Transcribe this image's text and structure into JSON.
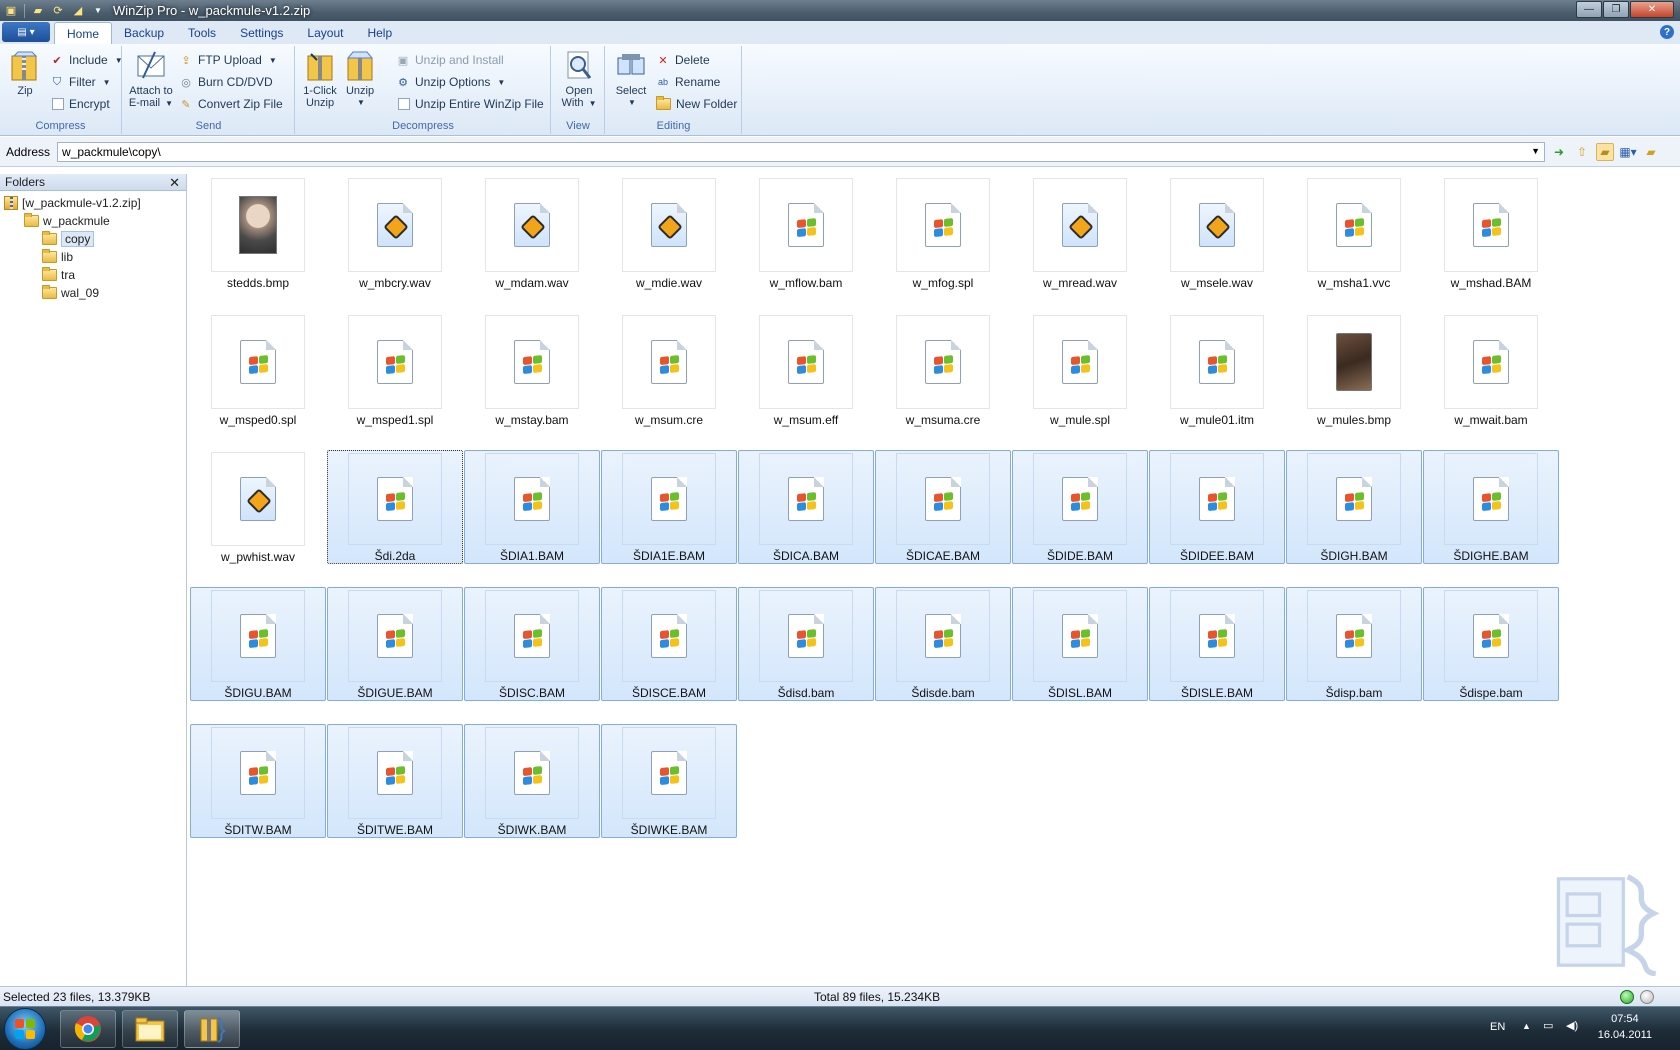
{
  "window": {
    "title": "WinZip Pro - w_packmule-v1.2.zip"
  },
  "tabs": [
    {
      "label": "Home",
      "active": true
    },
    {
      "label": "Backup"
    },
    {
      "label": "Tools"
    },
    {
      "label": "Settings"
    },
    {
      "label": "Layout"
    },
    {
      "label": "Help"
    }
  ],
  "ribbon": {
    "compress": {
      "label": "Compress",
      "zip": "Zip",
      "include": "Include",
      "filter": "Filter",
      "encrypt": "Encrypt"
    },
    "send": {
      "label": "Send",
      "attach_line1": "Attach to",
      "attach_line2": "E-mail",
      "ftp_upload": "FTP Upload",
      "burn": "Burn CD/DVD",
      "convert": "Convert Zip File"
    },
    "decompress": {
      "label": "Decompress",
      "oneclick_line1": "1-Click",
      "oneclick_line2": "Unzip",
      "unzip": "Unzip",
      "unzip_install": "Unzip and Install",
      "unzip_options": "Unzip Options",
      "unzip_entire": "Unzip Entire WinZip File"
    },
    "view": {
      "label": "View",
      "open_line1": "Open",
      "open_line2": "With"
    },
    "editing": {
      "label": "Editing",
      "select": "Select",
      "delete": "Delete",
      "rename": "Rename",
      "new_folder": "New Folder"
    }
  },
  "address": {
    "label": "Address",
    "value": "w_packmule\\copy\\"
  },
  "folders": {
    "header": "Folders",
    "root": "[w_packmule-v1.2.zip]",
    "child": "w_packmule",
    "items": [
      "copy",
      "lib",
      "tra",
      "wal_09"
    ],
    "selected": "copy"
  },
  "files": [
    {
      "name": "stedds.bmp",
      "type": "photo-person",
      "selected": false
    },
    {
      "name": "w_mbcry.wav",
      "type": "wav",
      "selected": false
    },
    {
      "name": "w_mdam.wav",
      "type": "wav",
      "selected": false
    },
    {
      "name": "w_mdie.wav",
      "type": "wav",
      "selected": false
    },
    {
      "name": "w_mflow.bam",
      "type": "win",
      "selected": false
    },
    {
      "name": "w_mfog.spl",
      "type": "win",
      "selected": false
    },
    {
      "name": "w_mread.wav",
      "type": "wav",
      "selected": false
    },
    {
      "name": "w_msele.wav",
      "type": "wav",
      "selected": false
    },
    {
      "name": "w_msha1.vvc",
      "type": "win",
      "selected": false
    },
    {
      "name": "w_mshad.BAM",
      "type": "win",
      "selected": false
    },
    {
      "name": "w_msped0.spl",
      "type": "win",
      "selected": false
    },
    {
      "name": "w_msped1.spl",
      "type": "win",
      "selected": false
    },
    {
      "name": "w_mstay.bam",
      "type": "win",
      "selected": false
    },
    {
      "name": "w_msum.cre",
      "type": "win",
      "selected": false
    },
    {
      "name": "w_msum.eff",
      "type": "win",
      "selected": false
    },
    {
      "name": "w_msuma.cre",
      "type": "win",
      "selected": false
    },
    {
      "name": "w_mule.spl",
      "type": "win",
      "selected": false
    },
    {
      "name": "w_mule01.itm",
      "type": "win",
      "selected": false
    },
    {
      "name": "w_mules.bmp",
      "type": "photo-horse",
      "selected": false
    },
    {
      "name": "w_mwait.bam",
      "type": "win",
      "selected": false
    },
    {
      "name": "w_pwhist.wav",
      "type": "wav",
      "selected": false
    },
    {
      "name": "Šdi.2da",
      "type": "win",
      "selected": true,
      "focus": true
    },
    {
      "name": "ŠDIA1.BAM",
      "type": "win",
      "selected": true
    },
    {
      "name": "ŠDIA1E.BAM",
      "type": "win",
      "selected": true
    },
    {
      "name": "ŠDICA.BAM",
      "type": "win",
      "selected": true
    },
    {
      "name": "ŠDICAE.BAM",
      "type": "win",
      "selected": true
    },
    {
      "name": "ŠDIDE.BAM",
      "type": "win",
      "selected": true
    },
    {
      "name": "ŠDIDEE.BAM",
      "type": "win",
      "selected": true
    },
    {
      "name": "ŠDIGH.BAM",
      "type": "win",
      "selected": true
    },
    {
      "name": "ŠDIGHE.BAM",
      "type": "win",
      "selected": true
    },
    {
      "name": "ŠDIGU.BAM",
      "type": "win",
      "selected": true
    },
    {
      "name": "ŠDIGUE.BAM",
      "type": "win",
      "selected": true
    },
    {
      "name": "ŠDISC.BAM",
      "type": "win",
      "selected": true
    },
    {
      "name": "ŠDISCE.BAM",
      "type": "win",
      "selected": true
    },
    {
      "name": "Šdisd.bam",
      "type": "win",
      "selected": true
    },
    {
      "name": "Šdisde.bam",
      "type": "win",
      "selected": true
    },
    {
      "name": "ŠDISL.BAM",
      "type": "win",
      "selected": true
    },
    {
      "name": "ŠDISLE.BAM",
      "type": "win",
      "selected": true
    },
    {
      "name": "Šdisp.bam",
      "type": "win",
      "selected": true
    },
    {
      "name": "Šdispe.bam",
      "type": "win",
      "selected": true
    },
    {
      "name": "ŠDITW.BAM",
      "type": "win",
      "selected": true
    },
    {
      "name": "ŠDITWE.BAM",
      "type": "win",
      "selected": true
    },
    {
      "name": "ŠDIWK.BAM",
      "type": "win",
      "selected": true
    },
    {
      "name": "ŠDIWKE.BAM",
      "type": "win",
      "selected": true
    }
  ],
  "status": {
    "selected": "Selected 23 files, 13.379KB",
    "total": "Total 89 files, 15.234KB"
  },
  "taskbar": {
    "lang": "EN",
    "time": "07:54",
    "date": "16.04.2011"
  },
  "colors": {
    "accent": "#15428b",
    "selection": "#d3e6fb",
    "selection_border": "#84acdd"
  }
}
